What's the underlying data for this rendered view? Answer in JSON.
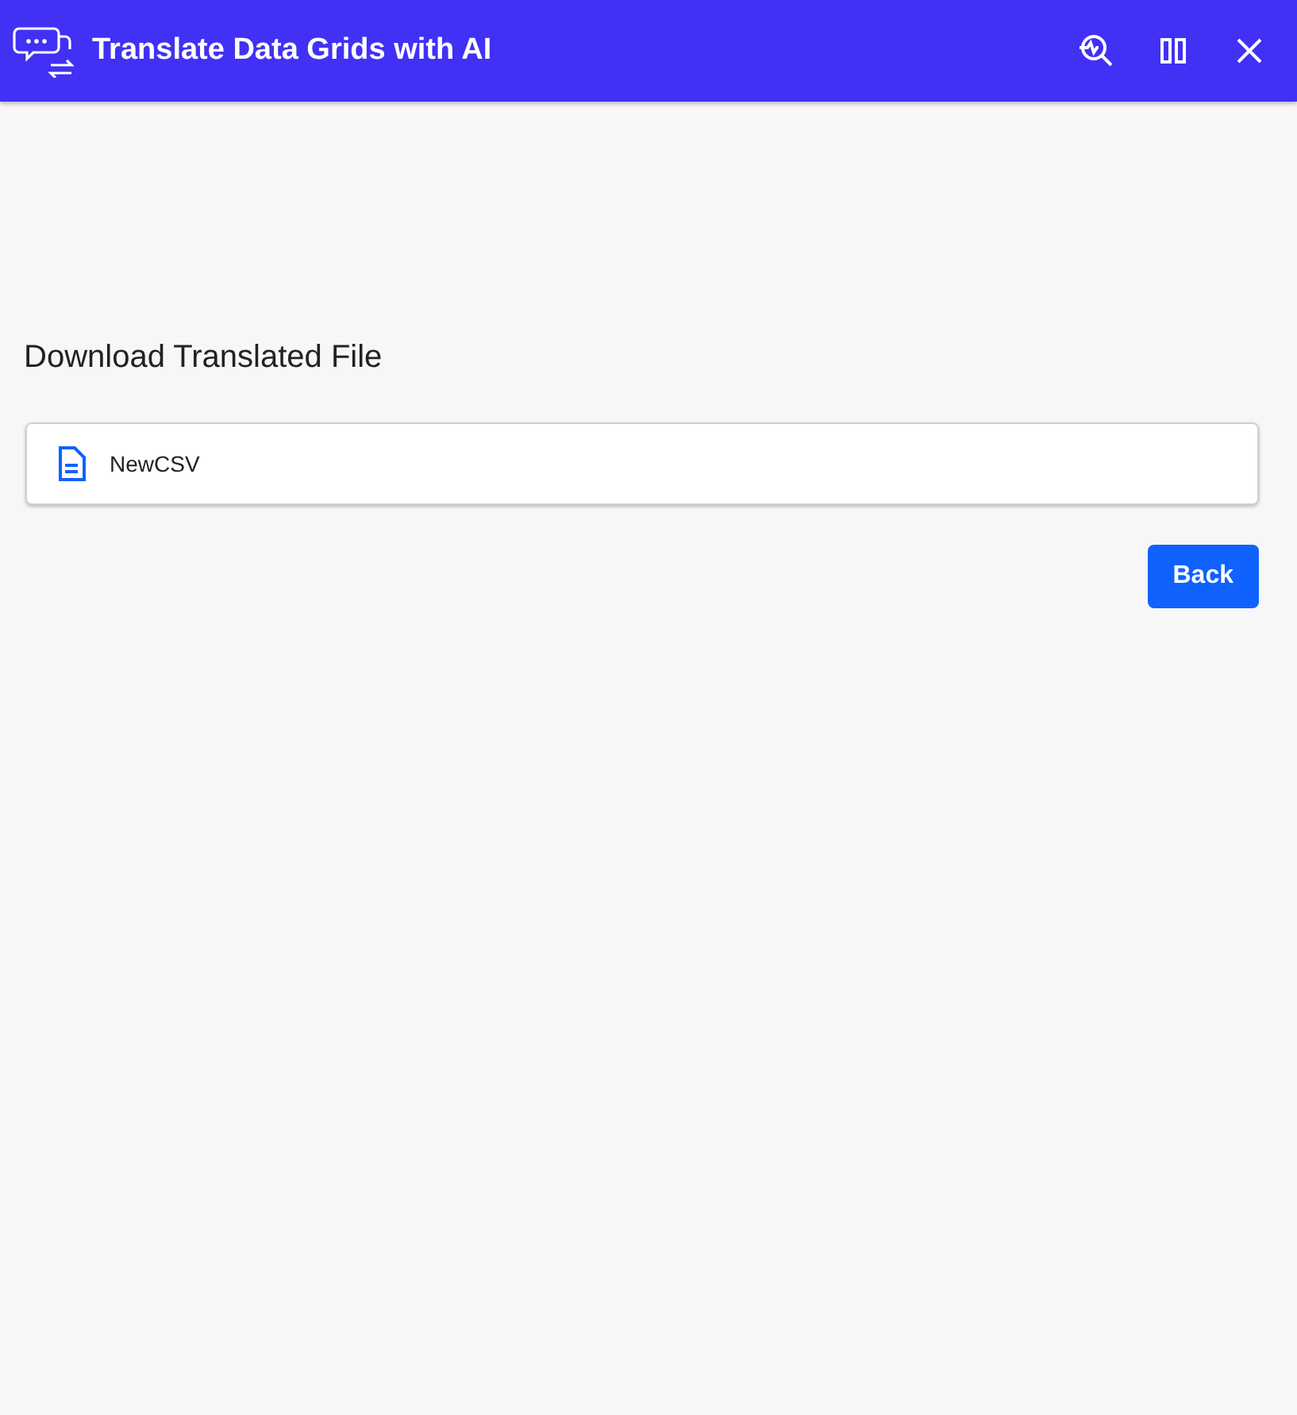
{
  "window": {
    "title": "Translate Data Grids with AI"
  },
  "section": {
    "title": "Download Translated File"
  },
  "files": [
    {
      "name": "NewCSV"
    }
  ],
  "buttons": [
    {
      "label": "Back"
    }
  ]
}
